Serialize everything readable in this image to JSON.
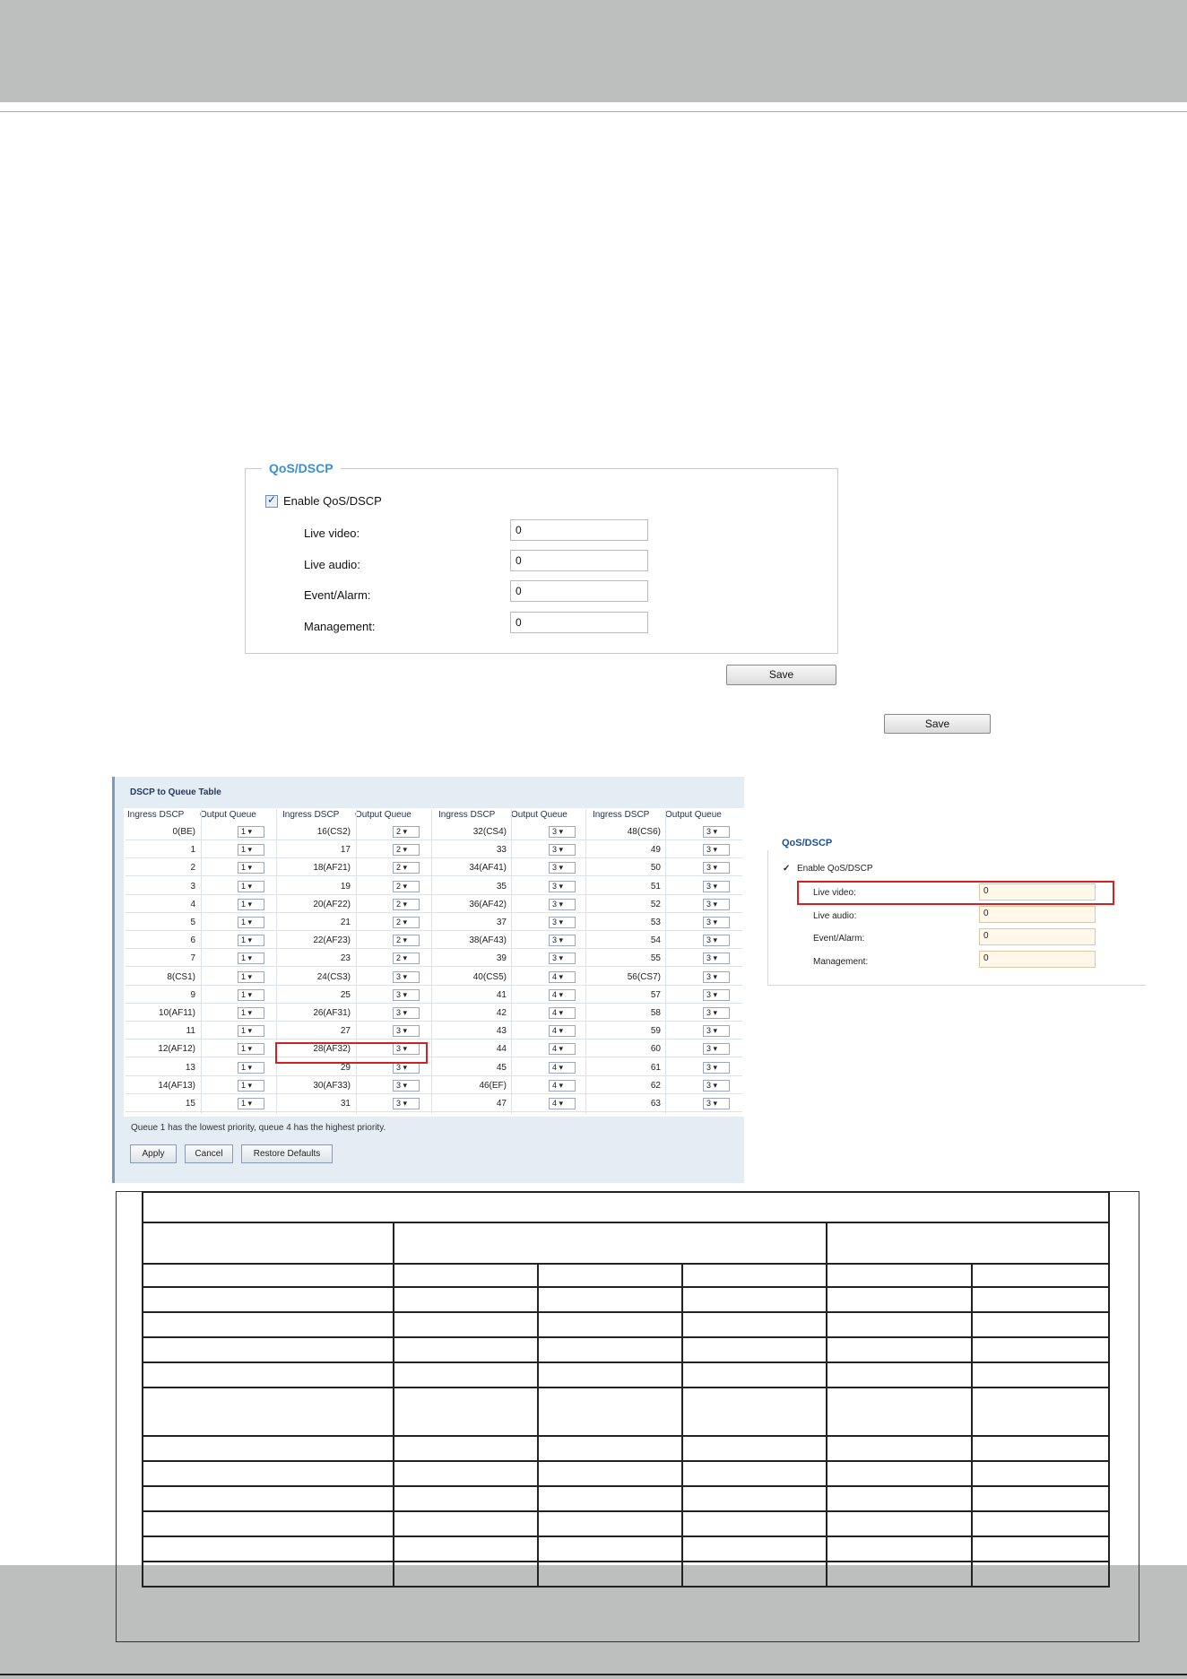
{
  "qos_panel": {
    "legend": "QoS/DSCP",
    "enable_label": "Enable QoS/DSCP",
    "enabled": true,
    "fields": [
      {
        "label": "Live video:",
        "value": "0"
      },
      {
        "label": "Live audio:",
        "value": "0"
      },
      {
        "label": "Event/Alarm:",
        "value": "0"
      },
      {
        "label": "Management:",
        "value": "0"
      }
    ],
    "save_label": "Save"
  },
  "extra_save_label": "Save",
  "dscp_table": {
    "title": "DSCP to Queue Table",
    "headers": [
      "Ingress DSCP",
      "Output Queue",
      "Ingress DSCP",
      "Output Queue",
      "Ingress DSCP",
      "Output Queue",
      "Ingress DSCP",
      "Output Queue"
    ],
    "rows": [
      [
        "0(BE)",
        "1",
        "16(CS2)",
        "2",
        "32(CS4)",
        "3",
        "48(CS6)",
        "3"
      ],
      [
        "1",
        "1",
        "17",
        "2",
        "33",
        "3",
        "49",
        "3"
      ],
      [
        "2",
        "1",
        "18(AF21)",
        "2",
        "34(AF41)",
        "3",
        "50",
        "3"
      ],
      [
        "3",
        "1",
        "19",
        "2",
        "35",
        "3",
        "51",
        "3"
      ],
      [
        "4",
        "1",
        "20(AF22)",
        "2",
        "36(AF42)",
        "3",
        "52",
        "3"
      ],
      [
        "5",
        "1",
        "21",
        "2",
        "37",
        "3",
        "53",
        "3"
      ],
      [
        "6",
        "1",
        "22(AF23)",
        "2",
        "38(AF43)",
        "3",
        "54",
        "3"
      ],
      [
        "7",
        "1",
        "23",
        "2",
        "39",
        "3",
        "55",
        "3"
      ],
      [
        "8(CS1)",
        "1",
        "24(CS3)",
        "3",
        "40(CS5)",
        "4",
        "56(CS7)",
        "3"
      ],
      [
        "9",
        "1",
        "25",
        "3",
        "41",
        "4",
        "57",
        "3"
      ],
      [
        "10(AF11)",
        "1",
        "26(AF31)",
        "3",
        "42",
        "4",
        "58",
        "3"
      ],
      [
        "11",
        "1",
        "27",
        "3",
        "43",
        "4",
        "59",
        "3"
      ],
      [
        "12(AF12)",
        "1",
        "28(AF32)",
        "3",
        "44",
        "4",
        "60",
        "3"
      ],
      [
        "13",
        "1",
        "29",
        "3",
        "45",
        "4",
        "61",
        "3"
      ],
      [
        "14(AF13)",
        "1",
        "30(AF33)",
        "3",
        "46(EF)",
        "4",
        "62",
        "3"
      ],
      [
        "15",
        "1",
        "31",
        "3",
        "47",
        "4",
        "63",
        "3"
      ]
    ],
    "note": "Queue 1 has the lowest priority, queue 4 has the highest priority.",
    "buttons": [
      "Apply",
      "Cancel",
      "Restore Defaults"
    ]
  },
  "qos_panel_small": {
    "title": "QoS/DSCP",
    "enable_label": "Enable QoS/DSCP",
    "fields": [
      {
        "label": "Live video:",
        "value": "0"
      },
      {
        "label": "Live audio:",
        "value": "0"
      },
      {
        "label": "Event/Alarm:",
        "value": "0"
      },
      {
        "label": "Management:",
        "value": "0"
      }
    ]
  },
  "colors": {
    "band": "#bdbebe",
    "legend_blue": "#3d8fd1",
    "highlight_red": "#d32020"
  }
}
